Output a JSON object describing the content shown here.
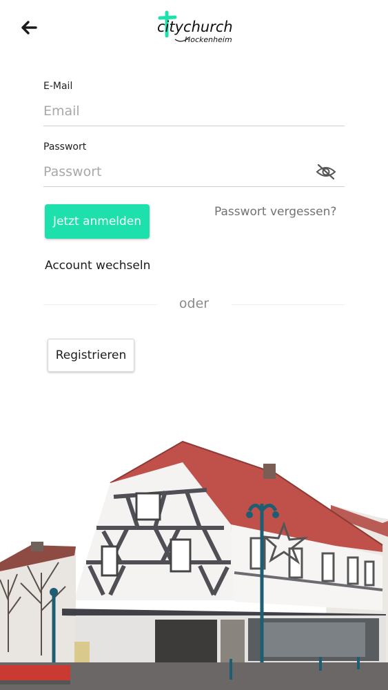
{
  "header": {
    "back_icon": "arrow-left-icon",
    "logo_text_main": "citychurch",
    "logo_text_sub": "Hockenheim"
  },
  "form": {
    "email": {
      "label": "E-Mail",
      "placeholder": "Email",
      "value": ""
    },
    "password": {
      "label": "Passwort",
      "placeholder": "Passwort",
      "value": "",
      "toggle_icon": "eye-slash-icon"
    },
    "login_label": "Jetzt anmelden",
    "forgot_label": "Passwort vergessen?",
    "switch_account_label": "Account wechseln",
    "divider_label": "oder",
    "register_label": "Registrieren"
  },
  "colors": {
    "accent": "#1ee0ad",
    "placeholder": "#a8a8a8",
    "roof": "#c0504a"
  },
  "background_image": "half-timbered-building-photo"
}
